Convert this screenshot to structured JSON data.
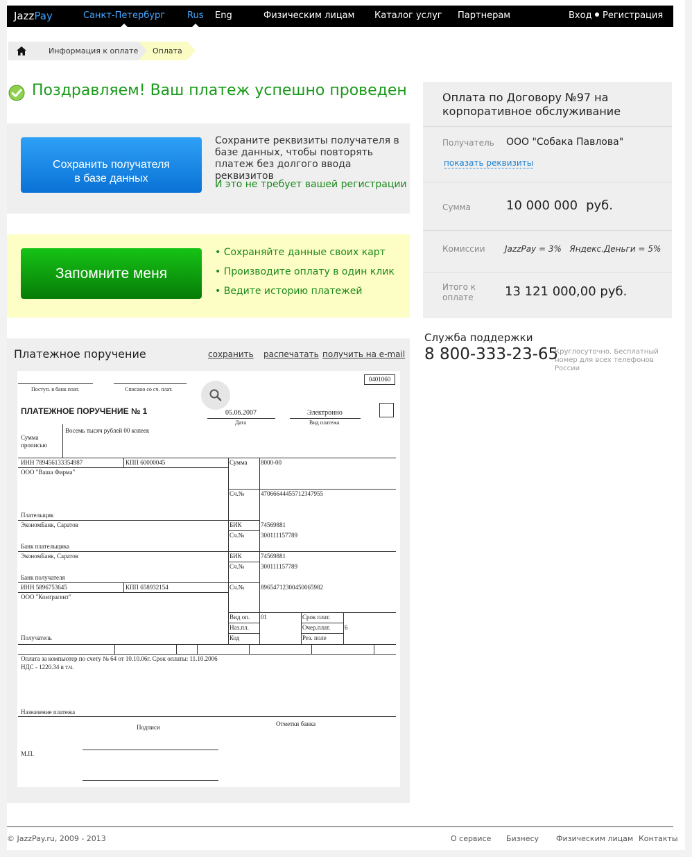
{
  "header": {
    "logo_part1": "Jazz",
    "logo_part2": "Pay",
    "city": "Санкт-Петербург",
    "lang_rus": "Rus",
    "lang_eng": "Eng",
    "nav": [
      "Физическим лицам",
      "Каталог услуг",
      "Партнерам"
    ],
    "login": "Вход",
    "register": "Регистрация"
  },
  "breadcrumb": {
    "items": [
      "Информация к оплате",
      "Оплата"
    ]
  },
  "success": {
    "message": "Поздравляем! Ваш платеж успешно проведен"
  },
  "save_recipient": {
    "button_line1": "Сохранить получателя",
    "button_line2": "в базе данных",
    "description": "Сохраните реквизиты получателя в базе данных, чтобы повторять платеж без долгого ввода реквизитов",
    "note": "И это не требует вашей регистрации"
  },
  "remember": {
    "button": "Запомните меня",
    "benefits": [
      "Сохраняйте данные своих карт",
      "Производите оплату в один клик",
      "Ведите историю платежей"
    ]
  },
  "payment_order": {
    "title": "Платежное поручение",
    "links": [
      "сохранить",
      "распечатать",
      "получить на e-mail"
    ],
    "form": {
      "code": "0401060",
      "received_label": "Поступ. в банк плат.",
      "debited_label": "Списано со сч. плат.",
      "heading": "ПЛАТЕЖНОЕ ПОРУЧЕНИЕ № 1",
      "date": "05.06.2007",
      "date_label": "Дата",
      "payment_kind": "Электронно",
      "payment_kind_label": "Вид платежа",
      "amount_words_label1": "Сумма",
      "amount_words_label2": "прописью",
      "amount_words": "Восемь тысяч рублей 00 копеек",
      "payer_inn": "ИНН  789456133354987",
      "payer_kpp": "КПП  60000045",
      "sum_label": "Сумма",
      "sum_value": "8000-00",
      "payer_name": "ООО \"Ваша Фирма\"",
      "acc_label": "Сч.№",
      "payer_account": "47066644455712347955",
      "payer_label": "Плательщик",
      "payer_bank": "ЭкономБанк, Саратов",
      "bik_label": "БИК",
      "payer_bank_bik": "74569881",
      "payer_bank_acc": "300111157789",
      "payer_bank_label": "Банк плательщика",
      "recipient_bank": "ЭкономБанк, Саратов",
      "recipient_bank_bik": "74569881",
      "recipient_bank_acc": "300111157789",
      "recipient_bank_label": "Банк получателя",
      "recipient_inn": "ИНН  5896753645",
      "recipient_kpp": "КПП  658932154",
      "recipient_account": "89654712300450065982",
      "recipient_name": "ООО \"Контрагент\"",
      "op_kind_label": "Вид оп.",
      "op_kind": "01",
      "purpose_code_label": "Наз.пл.",
      "code_label": "Код",
      "due_label": "Срок плат.",
      "priority_label": "Очер.плат.",
      "priority": "6",
      "reserve_label": "Рез. поле",
      "recipient_label": "Получатель",
      "purpose_line1": "Оплата за компьютер по счету № 64 от 10.10.06г. Срок оплаты: 11.10.2006",
      "purpose_line2": "НДС - 1220.34 в т.ч.",
      "purpose_label": "Назначение платежа",
      "signatures_label": "Подписи",
      "bank_marks_label": "Отметки банка",
      "stamp_label": "М.П."
    }
  },
  "summary": {
    "title": "Оплата по Договору №97 на корпоративное обслуживание",
    "recipient_label": "Получатель",
    "recipient_value": "ООО \"Собака Павлова\"",
    "show_details": "показать реквизиты",
    "amount_label": "Сумма",
    "amount_value": "10 000 000",
    "amount_currency": "руб.",
    "commission_label": "Комиссии",
    "commission_jazz": "JazzPay = 3%",
    "commission_yandex": "Яндекс.Деньги = 5%",
    "total_label_line1": "Итого к",
    "total_label_line2": "оплате",
    "total_value": "13 121 000,00 руб."
  },
  "support": {
    "title": "Служба поддержки",
    "phone": "8 800-333-23-65",
    "note": "Круглосуточно. Бесплатный номер для всех телефонов России"
  },
  "footer": {
    "copyright": "© JazzPay.ru, 2009 - 2013",
    "links": [
      "О сервисе",
      "Бизнесу",
      "Физическим лицам",
      "Контакты"
    ]
  },
  "colors": {
    "accent_blue": "#3aa0ff",
    "success_green": "#1a9a1a",
    "button_blue": "#0a72d6",
    "button_green": "#067c06",
    "highlight_yellow": "#fdfdc6"
  }
}
